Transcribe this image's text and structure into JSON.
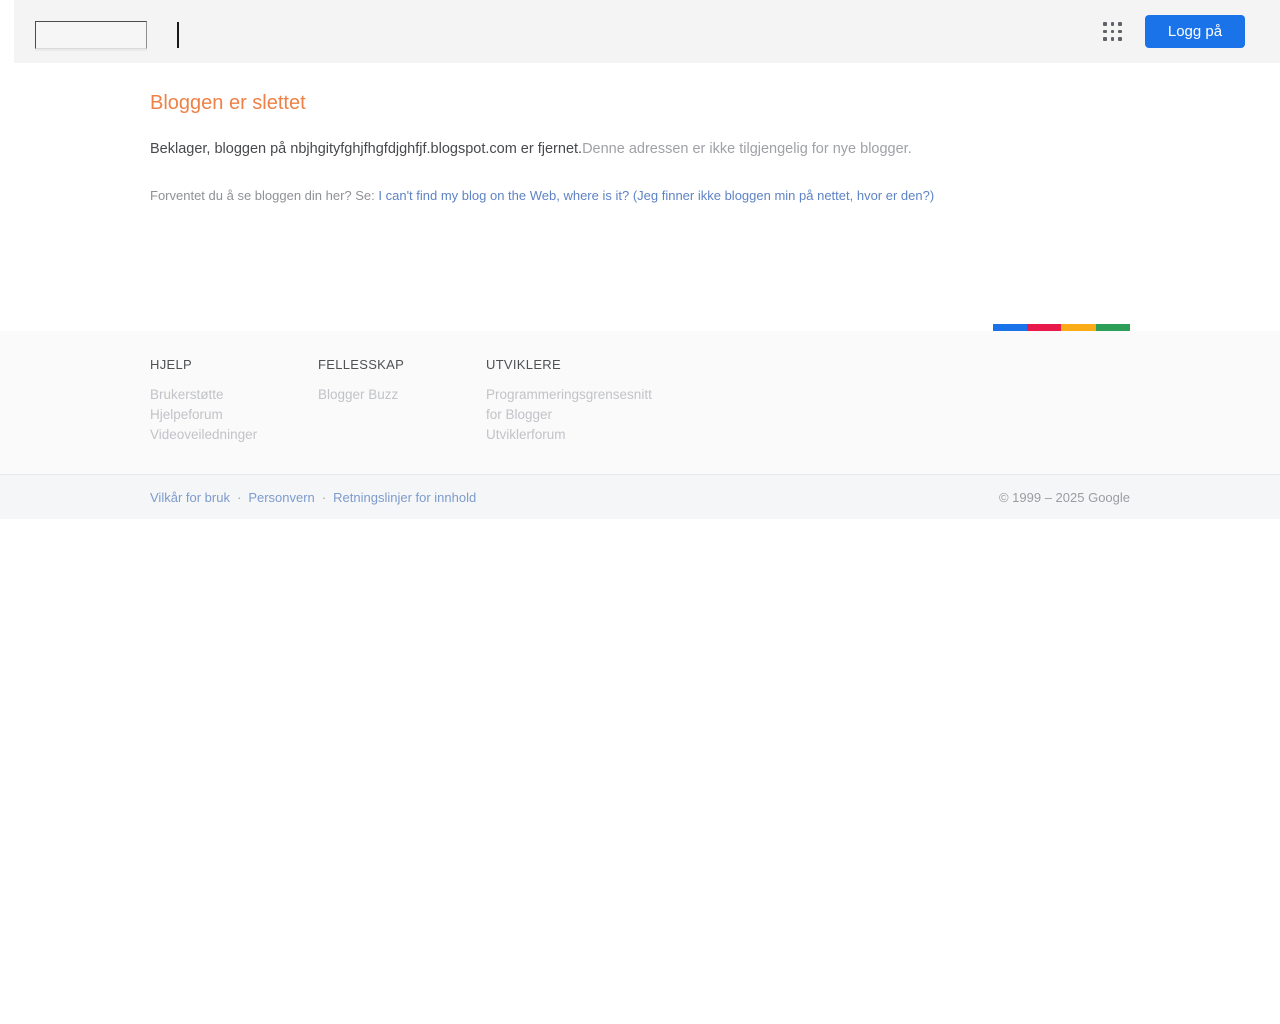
{
  "header": {
    "login_button": "Logg på"
  },
  "main": {
    "title": "Bloggen er slettet",
    "message_primary": "Beklager, bloggen på nbjhgityfghjfhgfdjghfjf.blogspot.com er fjernet.",
    "message_secondary": "Denne adressen er ikke tilgjengelig for nye blogger.",
    "help_prompt": "Forventet du å se bloggen din her? Se: ",
    "help_link": "I can't find my blog on the Web, where is it? (Jeg finner ikke bloggen min på nettet, hvor er den?)"
  },
  "footer": {
    "color_bar": [
      "#1a73e8",
      "#e8184a",
      "#fbab18",
      "#2d9e57"
    ],
    "columns": [
      {
        "heading": "HJELP",
        "links": [
          "Brukerstøtte",
          "Hjelpeforum",
          "Videoveiledninger"
        ]
      },
      {
        "heading": "FELLESSKAP",
        "links": [
          "Blogger Buzz"
        ]
      },
      {
        "heading": "UTVIKLERE",
        "links": [
          "Programmeringsgrensesnitt for Blogger",
          "Utviklerforum"
        ]
      }
    ],
    "legal_links": [
      "Vilkår for bruk",
      "Personvern",
      "Retningslinjer for innhold"
    ],
    "legal_separator": "·",
    "copyright": "© 1999 – 2025 Google"
  },
  "colors": {
    "header_background": "#f4f4f5",
    "accent_orange": "#ee8147",
    "button_blue": "#1a73e8",
    "link_blue": "#5e83c5",
    "footer_background": "#fafafa"
  }
}
